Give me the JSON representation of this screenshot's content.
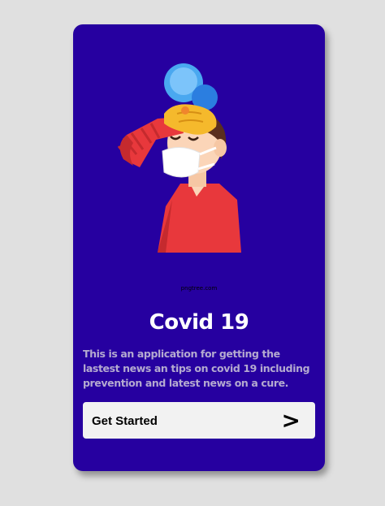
{
  "onboarding": {
    "illustration_icon": "sick-person-with-mask-icon",
    "watermark": "pngtree.com",
    "title": "Covid 19",
    "description": "This is an application for getting the lastest news an tips on covid 19 including prevention and latest news on a cure.",
    "cta_label": "Get Started",
    "cta_arrow": ">"
  },
  "colors": {
    "page_bg": "#e0e0e0",
    "card_bg": "#2600a0",
    "button_bg": "#f2f2f2",
    "title": "#ffffff",
    "description": "#b4aad0"
  }
}
